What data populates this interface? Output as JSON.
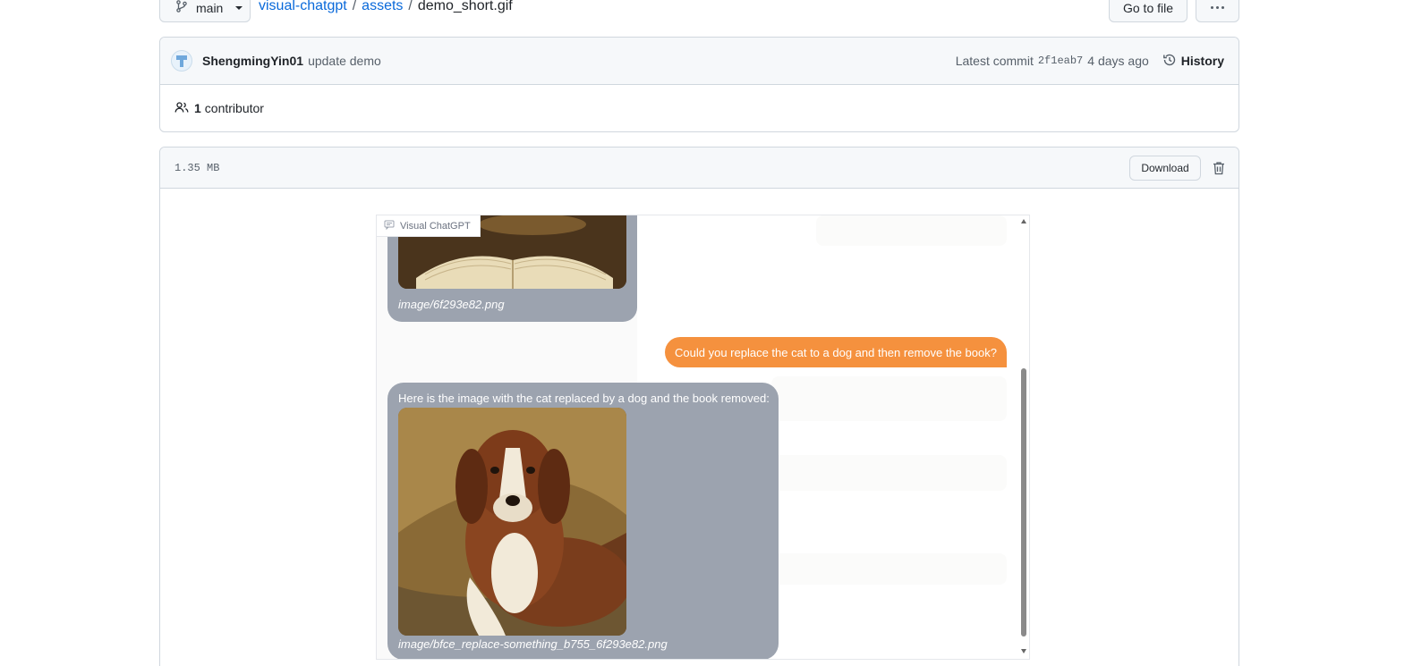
{
  "topbar": {
    "branch": "main",
    "breadcrumb": {
      "repo": "visual-chatgpt",
      "folder": "assets",
      "separator": "/",
      "file": "demo_short.gif"
    },
    "goto_file": "Go to file"
  },
  "commit": {
    "author": "ShengmingYin01",
    "message": "update demo",
    "latest_label": "Latest commit",
    "sha": "2f1eab7",
    "age": "4 days ago",
    "history": "History"
  },
  "contributors": {
    "count": "1",
    "label": "contributor"
  },
  "file": {
    "size": "1.35 MB",
    "download": "Download"
  },
  "preview": {
    "app_label": "Visual ChatGPT",
    "messages": [
      {
        "role": "bot",
        "caption": "image/6f293e82.png"
      },
      {
        "role": "user",
        "text": "Could you replace the cat to a dog and then remove the book?"
      },
      {
        "role": "bot",
        "text": "Here is the image with the cat replaced by a dog and the book removed:",
        "caption": "image/bfce_replace-something_b755_6f293e82.png"
      }
    ]
  },
  "colors": {
    "link": "#0969da",
    "user_bubble": "#f5913e",
    "bot_bubble": "#9ca3af"
  },
  "icons": [
    "git-branch-icon",
    "chevron-down-icon",
    "kebab-horizontal-icon",
    "avatar",
    "history-icon",
    "people-icon",
    "trash-icon",
    "chat-icon"
  ]
}
